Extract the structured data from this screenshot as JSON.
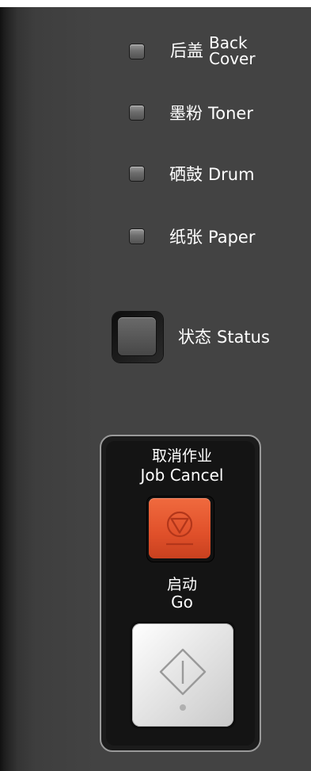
{
  "indicators": [
    {
      "zh": "后盖",
      "en_line1": "Back",
      "en_line2": "Cover"
    },
    {
      "zh": "墨粉",
      "en": "Toner"
    },
    {
      "zh": "硒鼓",
      "en": "Drum"
    },
    {
      "zh": "纸张",
      "en": "Paper"
    }
  ],
  "status": {
    "zh": "状态",
    "en": "Status"
  },
  "job_cancel": {
    "zh": "取消作业",
    "en": "Job Cancel"
  },
  "go": {
    "zh": "启动",
    "en": "Go"
  },
  "colors": {
    "panel": "#434343",
    "cancel_button": "#e0502a",
    "go_button": "#e6e6e6"
  }
}
